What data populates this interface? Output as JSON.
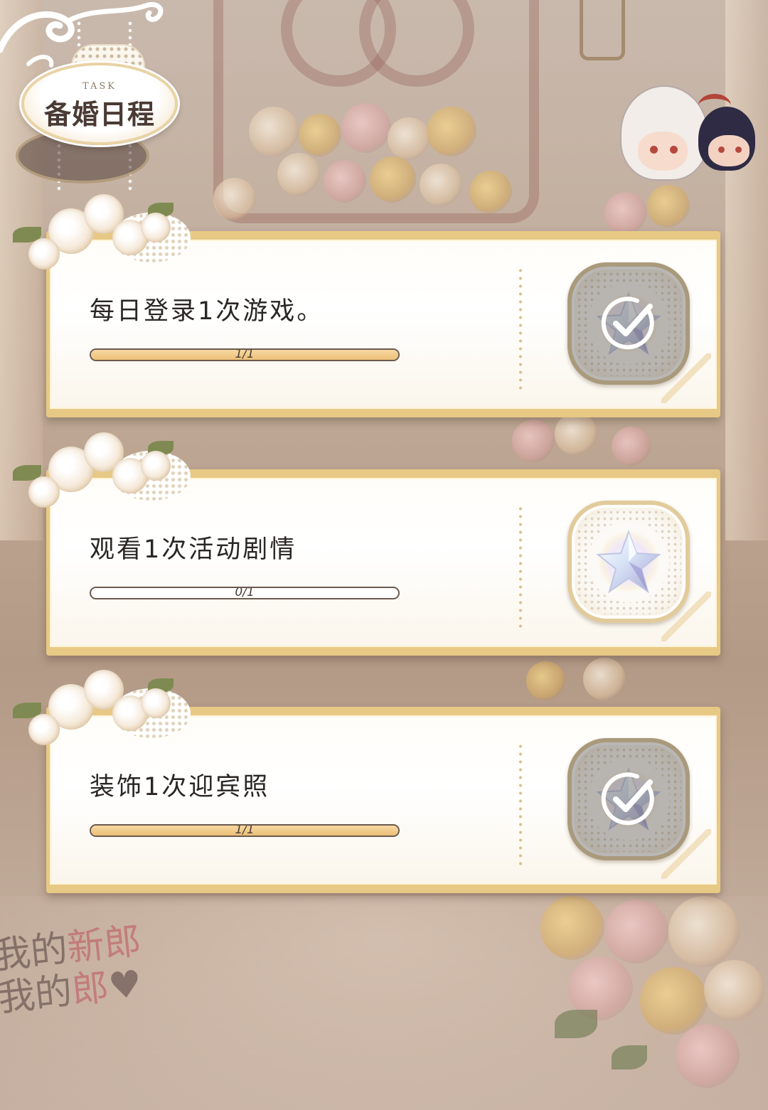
{
  "header": {
    "badge_subtitle": "TASK",
    "badge_title": "备婚日程"
  },
  "colors": {
    "card_border": "#e7c985",
    "progress_fill": "#ecbf77",
    "text": "#2a2624"
  },
  "tasks": [
    {
      "description": "每日登录1次游戏。",
      "progress_text": "1/1",
      "progress": 1,
      "reward_icon": "crystal-star-icon",
      "claimed": true
    },
    {
      "description": "观看1次活动剧情",
      "progress_text": "0/1",
      "progress": 0,
      "reward_icon": "crystal-star-icon",
      "claimed": false
    },
    {
      "description": "装饰1次迎宾照",
      "progress_text": "1/1",
      "progress": 1,
      "reward_icon": "crystal-star-icon",
      "claimed": true
    }
  ]
}
